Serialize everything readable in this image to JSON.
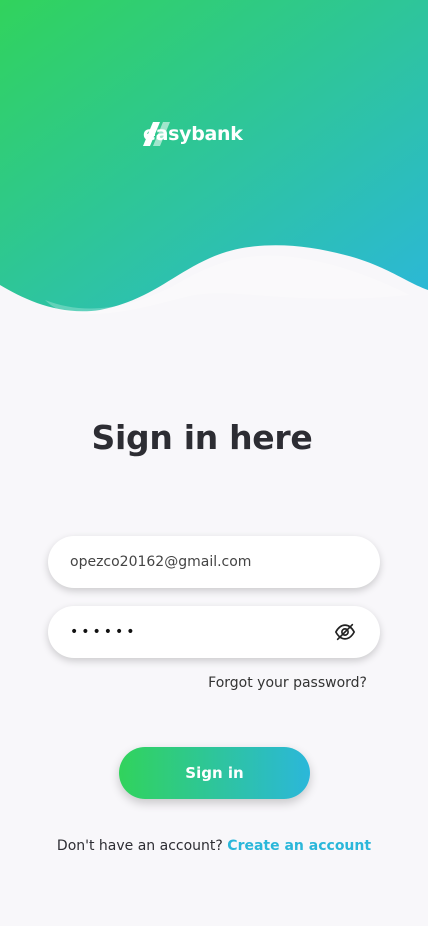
{
  "brand": {
    "name": "easybank",
    "gradient_start": "#31d35c",
    "gradient_end": "#2bb7da"
  },
  "header": {
    "title": "Sign in here"
  },
  "form": {
    "email_value": "opezco20162@gmail.com",
    "password_value": "••••••",
    "password_toggle_icon": "eye-off-icon",
    "forgot_label": "Forgot your password?",
    "submit_label": "Sign in"
  },
  "footer": {
    "prompt": "Don't have an account?",
    "create_link": "Create an account"
  }
}
